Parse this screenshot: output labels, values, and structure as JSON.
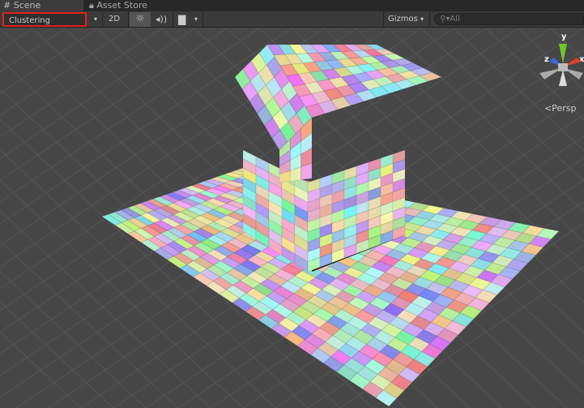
{
  "tabs": [
    {
      "label": "Scene",
      "icon": "grid-icon"
    },
    {
      "label": "Asset Store",
      "icon": "lock-icon"
    }
  ],
  "toolbar": {
    "draw_mode": "Clustering",
    "mode_2d": "2D",
    "lighting_icon": "sun-icon",
    "audio_icon": "speaker-icon",
    "effects_icon": "image-icon",
    "gizmos": "Gizmos",
    "search_placeholder": "All"
  },
  "gizmo": {
    "y": "y",
    "x": "x",
    "z": "z",
    "projection": "Persp"
  },
  "colors": {
    "highlight": "#e02020",
    "axis_x": "#e0402a",
    "axis_y": "#6cc82a",
    "axis_z": "#3c6ae0"
  }
}
